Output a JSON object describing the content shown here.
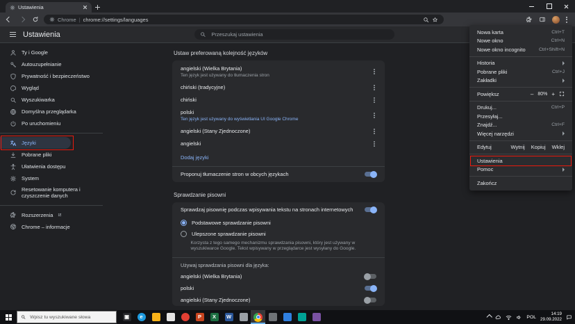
{
  "colors": {
    "accent_blue": "#8ab4f8",
    "annotation_red": "#ea1a0d"
  },
  "browser": {
    "tab_title": "Ustawienia",
    "url_product": "Chrome",
    "url_separator": "|",
    "url": "chrome://settings/languages"
  },
  "settings_header": {
    "title": "Ustawienia",
    "search_placeholder": "Przeszukaj ustawienia"
  },
  "sidebar": [
    {
      "label": "Ty i Google"
    },
    {
      "label": "Autouzupełnianie"
    },
    {
      "label": "Prywatność i bezpieczeństwo"
    },
    {
      "label": "Wygląd"
    },
    {
      "label": "Wyszukiwarka"
    },
    {
      "label": "Domyślna przeglądarka"
    },
    {
      "label": "Po uruchomieniu"
    },
    {
      "label": "Języki",
      "selected": true
    },
    {
      "label": "Pobrane pliki"
    },
    {
      "label": "Ułatwienia dostępu"
    },
    {
      "label": "System"
    },
    {
      "label": "Resetowanie komputera i czyszczenie danych"
    },
    {
      "label": "Rozszerzenia"
    },
    {
      "label": "Chrome – informacje"
    }
  ],
  "languages_section": {
    "title": "Ustaw preferowaną kolejność języków",
    "rows": [
      {
        "name": "angielski (Wielka Brytania)",
        "note": "Ten język jest używany do tłumaczenia stron"
      },
      {
        "name": "chiński (tradycyjne)",
        "note": ""
      },
      {
        "name": "chiński",
        "note": ""
      },
      {
        "name": "polski",
        "note": "Ten język jest używany do wyświetlania UI Google Chrome",
        "accent": true
      },
      {
        "name": "angielski (Stany Zjednoczone)",
        "note": ""
      },
      {
        "name": "angielski",
        "note": ""
      }
    ],
    "add_languages": "Dodaj języki",
    "translate_label": "Proponuj tłumaczenie stron w obcych językach",
    "translate_on": true
  },
  "spellcheck_section": {
    "title": "Sprawdzanie pisowni",
    "check_label": "Sprawdzaj pisownię podczas wpisywania tekstu na stronach internetowych",
    "check_on": true,
    "basic_option": "Podstawowe sprawdzanie pisowni",
    "enhanced_option": "Ulepszone sprawdzanie pisowni",
    "enhanced_description": "Korzysta z tego samego mechanizmu sprawdzania pisowni, który jest używany w wyszukiwarce Google. Tekst wpisywany w przeglądarce jest wysyłany do Google.",
    "use_for_label": "Używaj sprawdzania pisowni dla języka:",
    "language_toggles": [
      {
        "name": "angielski (Wielka Brytania)",
        "on": false
      },
      {
        "name": "polski",
        "on": true
      },
      {
        "name": "angielski (Stany Zjednoczone)",
        "on": false
      }
    ]
  },
  "app_menu": {
    "new_tab": {
      "label": "Nowa karta",
      "shortcut": "Ctrl+T"
    },
    "new_window": {
      "label": "Nowe okno",
      "shortcut": "Ctrl+N"
    },
    "new_incognito": {
      "label": "Nowe okno incognito",
      "shortcut": "Ctrl+Shift+N"
    },
    "history": {
      "label": "Historia"
    },
    "downloads": {
      "label": "Pobrane pliki",
      "shortcut": "Ctrl+J"
    },
    "bookmarks": {
      "label": "Zakładki"
    },
    "zoom": {
      "label": "Powiększ",
      "minus": "–",
      "value": "80%",
      "plus": "+"
    },
    "print": {
      "label": "Drukuj...",
      "shortcut": "Ctrl+P"
    },
    "cast": {
      "label": "Przesyłaj..."
    },
    "find": {
      "label": "Znajdź...",
      "shortcut": "Ctrl+F"
    },
    "more_tools": {
      "label": "Więcej narzędzi"
    },
    "edit": {
      "label": "Edytuj",
      "cut": "Wytnij",
      "copy": "Kopiuj",
      "paste": "Wklej"
    },
    "settings": {
      "label": "Ustawienia"
    },
    "help": {
      "label": "Pomoc"
    },
    "exit": {
      "label": "Zakończ"
    }
  },
  "taskbar": {
    "search_placeholder": "Wpisz tu wyszukiwane słowa",
    "language": "POL",
    "time": "14:19",
    "date": "29.09.2022",
    "apps": [
      {
        "name": "task-view",
        "color": "#26272b",
        "glyph": "▣"
      },
      {
        "name": "edge",
        "color": "#1e9be0",
        "glyph": "e"
      },
      {
        "name": "file-explorer",
        "color": "#f8b219",
        "glyph": ""
      },
      {
        "name": "app-light",
        "color": "#e4e4e4",
        "glyph": ""
      },
      {
        "name": "app-red",
        "color": "#e23f33",
        "glyph": ""
      },
      {
        "name": "powerpoint",
        "color": "#c8441f",
        "glyph": "P"
      },
      {
        "name": "excel",
        "color": "#1d6f42",
        "glyph": "X"
      },
      {
        "name": "word",
        "color": "#2b579a",
        "glyph": "W"
      },
      {
        "name": "libreoffice",
        "color": "#9aa0a6",
        "glyph": ""
      },
      {
        "name": "chrome",
        "color": "",
        "glyph": "",
        "active": true
      },
      {
        "name": "app-gray",
        "color": "#6f7377",
        "glyph": ""
      },
      {
        "name": "app-blue",
        "color": "#2f7fe0",
        "glyph": ""
      },
      {
        "name": "app-teal",
        "color": "#00a295",
        "glyph": ""
      },
      {
        "name": "app-purple",
        "color": "#7a52a3",
        "glyph": ""
      }
    ]
  }
}
